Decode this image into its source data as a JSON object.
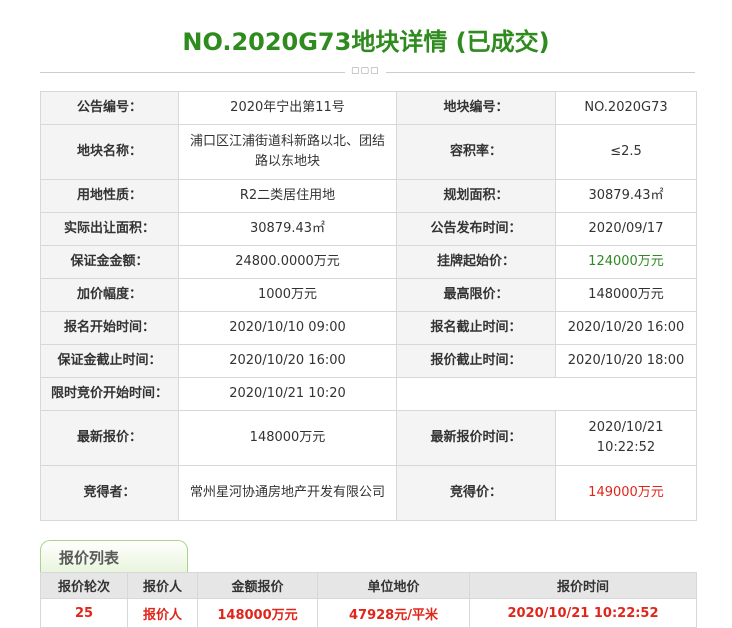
{
  "page_title": "NO.2020G73地块详情 (已成交)",
  "divider_mark": "▢▢▢",
  "details": {
    "notice_no_label": "公告编号：",
    "notice_no": "2020年宁出第11号",
    "plot_no_label": "地块编号：",
    "plot_no": "NO.2020G73",
    "plot_name_label": "地块名称：",
    "plot_name": "浦口区江浦街道科新路以北、团结路以东地块",
    "far_label": "容积率：",
    "far": "≤2.5",
    "land_use_label": "用地性质：",
    "land_use": "R2二类居住用地",
    "planned_area_label": "规划面积：",
    "planned_area": "30879.43㎡",
    "actual_area_label": "实际出让面积：",
    "actual_area": "30879.43㎡",
    "announce_time_label": "公告发布时间：",
    "announce_time": "2020/09/17",
    "deposit_label": "保证金金额：",
    "deposit": "24800.0000万元",
    "start_price_label": "挂牌起始价：",
    "start_price": "124000万元",
    "increment_label": "加价幅度：",
    "increment": "1000万元",
    "max_price_label": "最高限价：",
    "max_price": "148000万元",
    "reg_start_label": "报名开始时间：",
    "reg_start": "2020/10/10 09:00",
    "reg_end_label": "报名截止时间：",
    "reg_end": "2020/10/20 16:00",
    "deposit_end_label": "保证金截止时间：",
    "deposit_end": "2020/10/20 16:00",
    "quote_end_label": "报价截止时间：",
    "quote_end": "2020/10/20 18:00",
    "limited_bid_start_label": "限时竞价开始时间：",
    "limited_bid_start": "2020/10/21 10:20",
    "latest_quote_label": "最新报价：",
    "latest_quote": "148000万元",
    "latest_quote_time_label": "最新报价时间：",
    "latest_quote_time": "2020/10/21 10:22:52",
    "winner_label": "竞得者：",
    "winner": "常州星河协通房地产开发有限公司",
    "winning_price_label": "竞得价：",
    "winning_price": "149000万元"
  },
  "bid_tab": {
    "label": "报价列表"
  },
  "bid_table": {
    "headers": [
      "报价轮次",
      "报价人",
      "金额报价",
      "单位地价",
      "报价时间"
    ],
    "rows": [
      [
        "25",
        "报价人",
        "148000万元",
        "47928元/平米",
        "2020/10/21 10:22:52"
      ]
    ]
  },
  "colors": {
    "title_green": "#2e8b1d",
    "price_green": "#2f8a25",
    "price_red": "#e0261b",
    "tab_border": "#aad38d"
  }
}
